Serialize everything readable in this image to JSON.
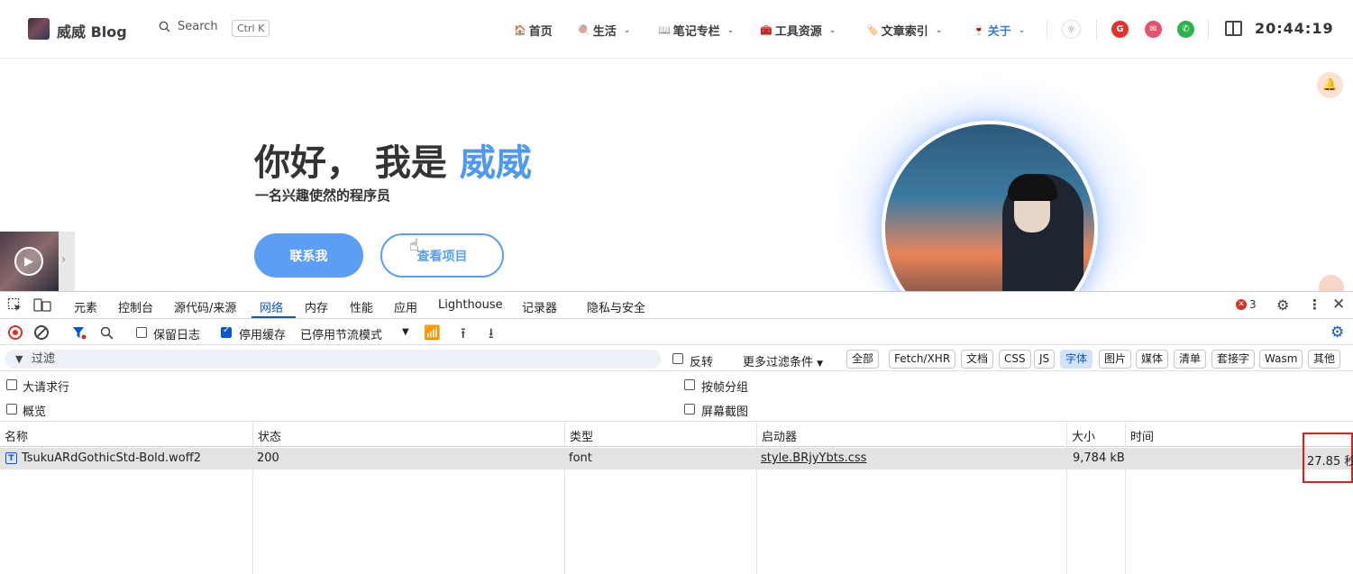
{
  "nav": {
    "site_name": "威威 Blog",
    "search_label": "Search",
    "search_shortcut": "Ctrl K",
    "menu": [
      {
        "emoji": "🏠",
        "label": "首页",
        "dropdown": false
      },
      {
        "emoji": "🍭",
        "label": "生活",
        "dropdown": true
      },
      {
        "emoji": "📖",
        "label": "笔记专栏",
        "dropdown": true
      },
      {
        "emoji": "🧰",
        "label": "工具资源",
        "dropdown": true
      },
      {
        "emoji": "🏷️",
        "label": "文章索引",
        "dropdown": true
      },
      {
        "emoji": "🍷",
        "label": "关于",
        "dropdown": true
      }
    ],
    "social": [
      {
        "name": "gitee-icon",
        "glyph": "G",
        "color": "#e5322d"
      },
      {
        "name": "email-icon",
        "glyph": "✉",
        "color": "#e8506a"
      },
      {
        "name": "wechat-icon",
        "glyph": "✆",
        "color": "#2bb34a"
      }
    ],
    "clock": "20:44:19",
    "accent_color": "#4e98f0"
  },
  "hero": {
    "title_prefix": "你好， 我是 ",
    "title_name": "威威",
    "subtitle": "一名兴趣使然的程序员",
    "contact_button": "联系我",
    "project_button": "查看项目"
  },
  "devtools": {
    "tabs": [
      "元素",
      "控制台",
      "源代码/来源",
      "网络",
      "内存",
      "性能",
      "应用",
      "Lighthouse",
      "记录器",
      "隐私与安全"
    ],
    "active_tab": "网络",
    "error_count": "3",
    "toolbar": {
      "preserve_log": "保留日志",
      "preserve_log_checked": false,
      "disable_cache": "停用缓存",
      "disable_cache_checked": true,
      "throttling": "已停用节流模式"
    },
    "filter": {
      "placeholder": "过滤",
      "invert": "反转",
      "more_filters": "更多过滤条件",
      "types": [
        "全部",
        "Fetch/XHR",
        "文档",
        "CSS",
        "JS",
        "字体",
        "图片",
        "媒体",
        "清单",
        "套接字",
        "Wasm",
        "其他"
      ],
      "active_type": "字体"
    },
    "options": {
      "big_rows": "大请求行",
      "group_by_frame": "按帧分组",
      "overview": "概览",
      "screenshots": "屏幕截图"
    },
    "table": {
      "columns": [
        "名称",
        "状态",
        "类型",
        "启动器",
        "大小",
        "时间"
      ],
      "rows": [
        {
          "name": "TsukuARdGothicStd-Bold.woff2",
          "status": "200",
          "type": "font",
          "initiator": "style.BRjyYbts.css",
          "size": "9,784 kB",
          "time": "27.85 秒"
        }
      ]
    }
  }
}
